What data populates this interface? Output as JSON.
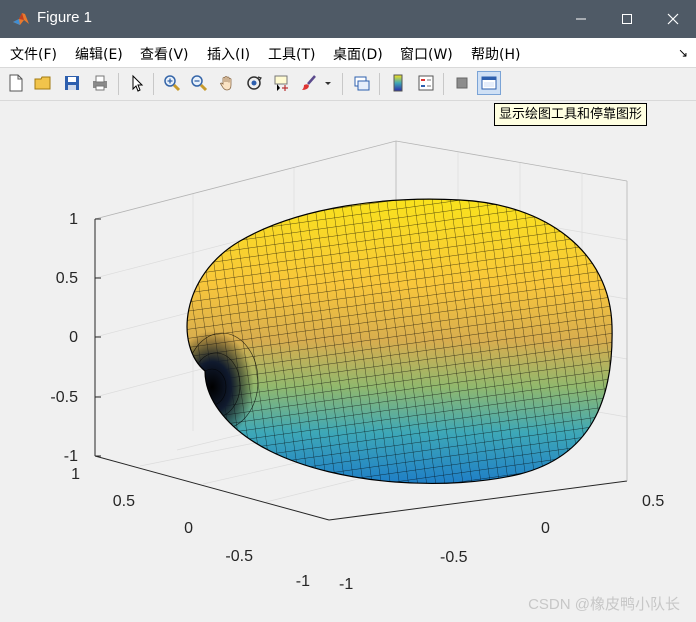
{
  "window": {
    "title": "Figure 1",
    "controls": [
      "minimize",
      "maximize",
      "close"
    ]
  },
  "menu": {
    "items": [
      "文件(F)",
      "编辑(E)",
      "查看(V)",
      "插入(I)",
      "工具(T)",
      "桌面(D)",
      "窗口(W)",
      "帮助(H)"
    ]
  },
  "toolbar": {
    "icons": [
      "new-figure-icon",
      "open-file-icon",
      "save-icon",
      "print-icon",
      "select-arrow-icon",
      "zoom-in-icon",
      "zoom-out-icon",
      "pan-hand-icon",
      "rotate-3d-icon",
      "data-cursor-icon",
      "brush-icon",
      "brush-dropdown-icon",
      "link-plot-icon",
      "insert-colorbar-icon",
      "insert-legend-icon",
      "hide-plot-tools-icon",
      "show-plot-tools-icon"
    ],
    "tooltip": "显示绘图工具和停靠图形"
  },
  "chart_data": {
    "type": "surface3d",
    "title": "",
    "grid": true,
    "colormap": "parula",
    "xlim": [
      -1,
      0.5
    ],
    "ylim": [
      -1,
      1
    ],
    "zlim": [
      -1,
      1
    ],
    "x_ticks": [
      "-1",
      "-0.5",
      "0",
      "0.5"
    ],
    "y_ticks": [
      "-1",
      "-0.5",
      "0",
      "0.5",
      "1"
    ],
    "z_ticks": [
      "-1",
      "-0.5",
      "0",
      "0.5",
      "1"
    ],
    "colors": {
      "low": "#3ea8b7",
      "mid": "#f6b04a",
      "high": "#f9e21c"
    }
  },
  "watermark": "CSDN @橡皮鸭小队长"
}
